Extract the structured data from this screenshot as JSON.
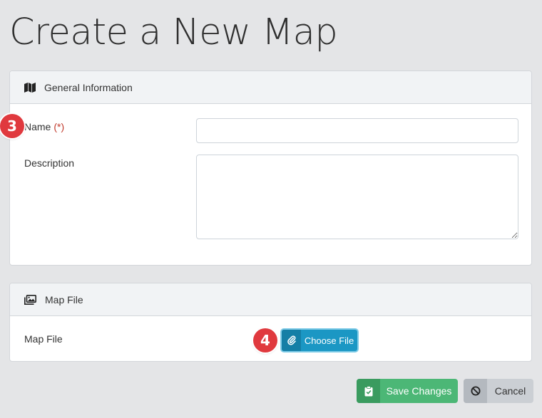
{
  "page": {
    "title": "Create a New Map"
  },
  "general": {
    "header": "General Information",
    "name_label": "Name",
    "required_marker": "(*)",
    "name_value": "",
    "description_label": "Description",
    "description_value": ""
  },
  "map_file": {
    "header": "Map File",
    "field_label": "Map File",
    "choose_label": "Choose File"
  },
  "actions": {
    "save_label": "Save Changes",
    "cancel_label": "Cancel"
  },
  "badges": {
    "step_name": "3",
    "step_file": "4"
  },
  "colors": {
    "save": "#4cb776",
    "cancel": "#cbcfd4",
    "choose_file": "#1b97c4",
    "badge": "#e0393e",
    "required": "#c0392b"
  }
}
